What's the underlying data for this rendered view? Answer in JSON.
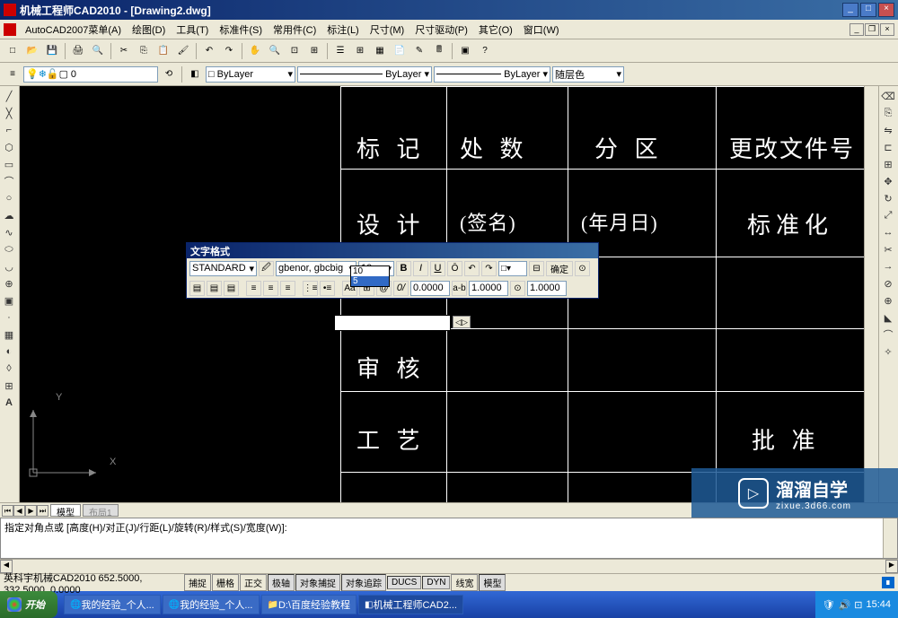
{
  "title": "机械工程师CAD2010 - [Drawing2.dwg]",
  "menu": {
    "app": "AutoCAD2007菜单(A)",
    "items": [
      "绘图(D)",
      "工具(T)",
      "标准件(S)",
      "常用件(C)",
      "标注(L)",
      "尺寸(M)",
      "尺寸驱动(P)",
      "其它(O)",
      "窗口(W)"
    ]
  },
  "layer": {
    "current": "0"
  },
  "props": {
    "bylayer1": "ByLayer",
    "bylayer2": "ByLayer",
    "bylayer3": "ByLayer",
    "color": "随层色"
  },
  "text_format": {
    "title": "文字格式",
    "style": "STANDARD",
    "font": "gbenor, gbcbig",
    "size": "10",
    "size_options": [
      "10",
      "5"
    ],
    "ok": "确定",
    "spin1": "0.0000",
    "spin2": "1.0000",
    "spin3": "1.0000"
  },
  "canvas_cells": {
    "r1c1": "标 记",
    "r1c2": "处 数",
    "r1c3": "分  区",
    "r1c4": "更改文件号",
    "r2c1": "设 计",
    "r2c2": "(签名)",
    "r2c3": "(年月日)",
    "r2c4": "标准化",
    "r3c1": "审 核",
    "r4c1": "工 艺",
    "r4c4": "批  准"
  },
  "tabs": {
    "model": "模型",
    "layout": "布局1"
  },
  "command": {
    "line1": "",
    "line2": "指定对角点或 [高度(H)/对正(J)/行距(L)/旋转(R)/样式(S)/宽度(W)]:"
  },
  "status": {
    "app": "英科宇机械CAD2010",
    "coords": "652.5000, 332.5000, 0.0000",
    "buttons": [
      "捕捉",
      "栅格",
      "正交",
      "极轴",
      "对象捕捉",
      "对象追踪",
      "DUCS",
      "DYN",
      "线宽",
      "模型"
    ]
  },
  "taskbar": {
    "start": "开始",
    "items": [
      "我的经验_个人...",
      "我的经验_个人...",
      "D:\\百度经验教程",
      "机械工程师CAD2..."
    ],
    "time": "15:44"
  },
  "watermark": {
    "brand": "溜溜自学",
    "url": "zixue.3d66.com"
  }
}
